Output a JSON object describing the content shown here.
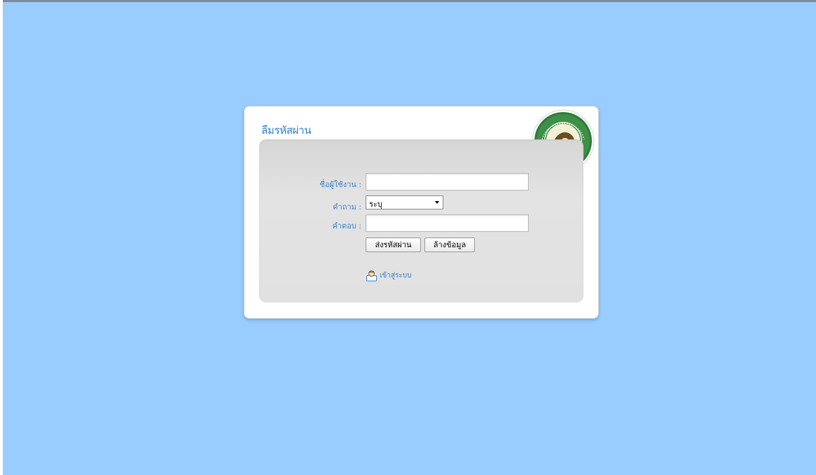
{
  "page": {
    "background_color": "#99ccff"
  },
  "card": {
    "title": "ลืมรหัสผ่าน",
    "emblem_icon": "department-of-local-administration-emblem"
  },
  "form": {
    "username_label": "ชื่อผู้ใช้งาน :",
    "username_value": "",
    "question_label": "คำถาม :",
    "question_selected": "ระบุ",
    "answer_label": "คำตอบ :",
    "answer_value": "",
    "submit_label": "ส่งรหัสผ่าน",
    "clear_label": "ล้างข้อมูล"
  },
  "login_link": {
    "label": "เข้าสู่ระบบ",
    "icon": "user-login-icon"
  },
  "colors": {
    "accent": "#2a7fd0",
    "label": "#3a83c8"
  }
}
